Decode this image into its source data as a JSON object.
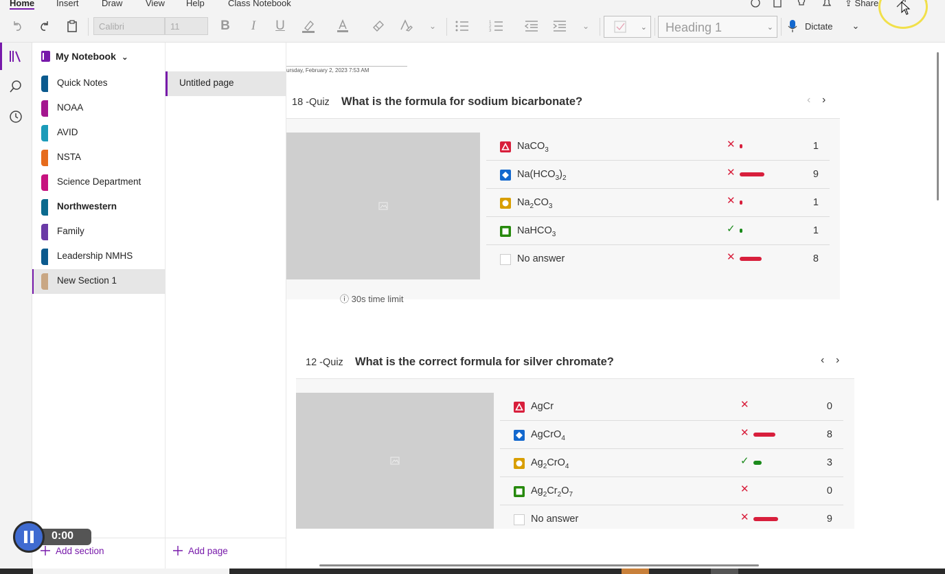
{
  "menu": {
    "tabs": [
      {
        "label": "Home",
        "active": true
      },
      {
        "label": "Insert"
      },
      {
        "label": "Draw"
      },
      {
        "label": "View"
      },
      {
        "label": "Help"
      },
      {
        "label": "Class Notebook"
      }
    ],
    "share_label": "Share"
  },
  "toolbar": {
    "font_name": "Calibri",
    "font_size": "11",
    "style": "Heading 1",
    "dictate_label": "Dictate"
  },
  "notebook": {
    "title": "My Notebook",
    "sections": [
      {
        "label": "Quick Notes",
        "color": "#0b5a8e"
      },
      {
        "label": "NOAA",
        "color": "#a4168f"
      },
      {
        "label": "AVID",
        "color": "#1b9bb9"
      },
      {
        "label": "NSTA",
        "color": "#e66b1c"
      },
      {
        "label": "Science Department",
        "color": "#c7127f"
      },
      {
        "label": "Northwestern",
        "color": "#0b6a8e",
        "bold": true
      },
      {
        "label": "Family",
        "color": "#6a3aa6"
      },
      {
        "label": "Leadership NMHS",
        "color": "#0b5a8e"
      },
      {
        "label": "New Section 1",
        "color": "#c9a784",
        "selected": true
      }
    ],
    "add_section_label": "Add section"
  },
  "pages": {
    "items": [
      {
        "label": "Untitled page",
        "selected": true
      }
    ],
    "add_page_label": "Add page"
  },
  "canvas": {
    "date_text": "ursday, February 2, 2023        7:53 AM",
    "quizzes": [
      {
        "number": "18 -Quiz",
        "question": "What is the formula for sodium bicarbonate?",
        "time_limit": "30s time limit",
        "options": [
          {
            "shape": "triangle",
            "color": "#d81f3c",
            "label": "NaCO",
            "sub": "3",
            "correct": false,
            "count": "1",
            "share": 0.07
          },
          {
            "shape": "diamond",
            "color": "#1368ce",
            "label": "Na(HCO",
            "sub": "3",
            "suffix": ")",
            "sub2": "2",
            "correct": false,
            "count": "9",
            "share": 0.6
          },
          {
            "shape": "circle",
            "color": "#d89e00",
            "label": "Na",
            "sub": "2",
            "suffix": "CO",
            "sub2": "3",
            "correct": false,
            "count": "1",
            "share": 0.07
          },
          {
            "shape": "square",
            "color": "#26890c",
            "label": "NaHCO",
            "sub": "3",
            "correct": true,
            "count": "1",
            "share": 0.07
          },
          {
            "shape": "none",
            "color": "#cccccc",
            "label": "No answer",
            "correct": false,
            "count": "8",
            "share": 0.53
          }
        ]
      },
      {
        "number": "12 -Quiz",
        "question": "What is the correct formula for silver chromate?",
        "options": [
          {
            "shape": "triangle",
            "color": "#d81f3c",
            "label": "AgCr",
            "correct": false,
            "count": "0",
            "share": 0
          },
          {
            "shape": "diamond",
            "color": "#1368ce",
            "label": "AgCrO",
            "sub": "4",
            "correct": false,
            "count": "8",
            "share": 0.53
          },
          {
            "shape": "circle",
            "color": "#d89e00",
            "label": "Ag",
            "sub": "2",
            "suffix": "CrO",
            "sub2": "4",
            "correct": true,
            "count": "3",
            "share": 0.2
          },
          {
            "shape": "square",
            "color": "#26890c",
            "label": "Ag",
            "sub": "2",
            "suffix": "Cr",
            "sub2": "2",
            "suffix2": "O",
            "sub3": "7",
            "correct": false,
            "count": "0",
            "share": 0
          },
          {
            "shape": "none",
            "color": "#cccccc",
            "label": "No answer",
            "correct": false,
            "count": "9",
            "share": 0.6
          }
        ]
      }
    ]
  },
  "recorder": {
    "time": "0:00"
  },
  "colors": {
    "accent": "#7719aa",
    "wrong": "#d81f3c",
    "right": "#1b8a1b"
  }
}
